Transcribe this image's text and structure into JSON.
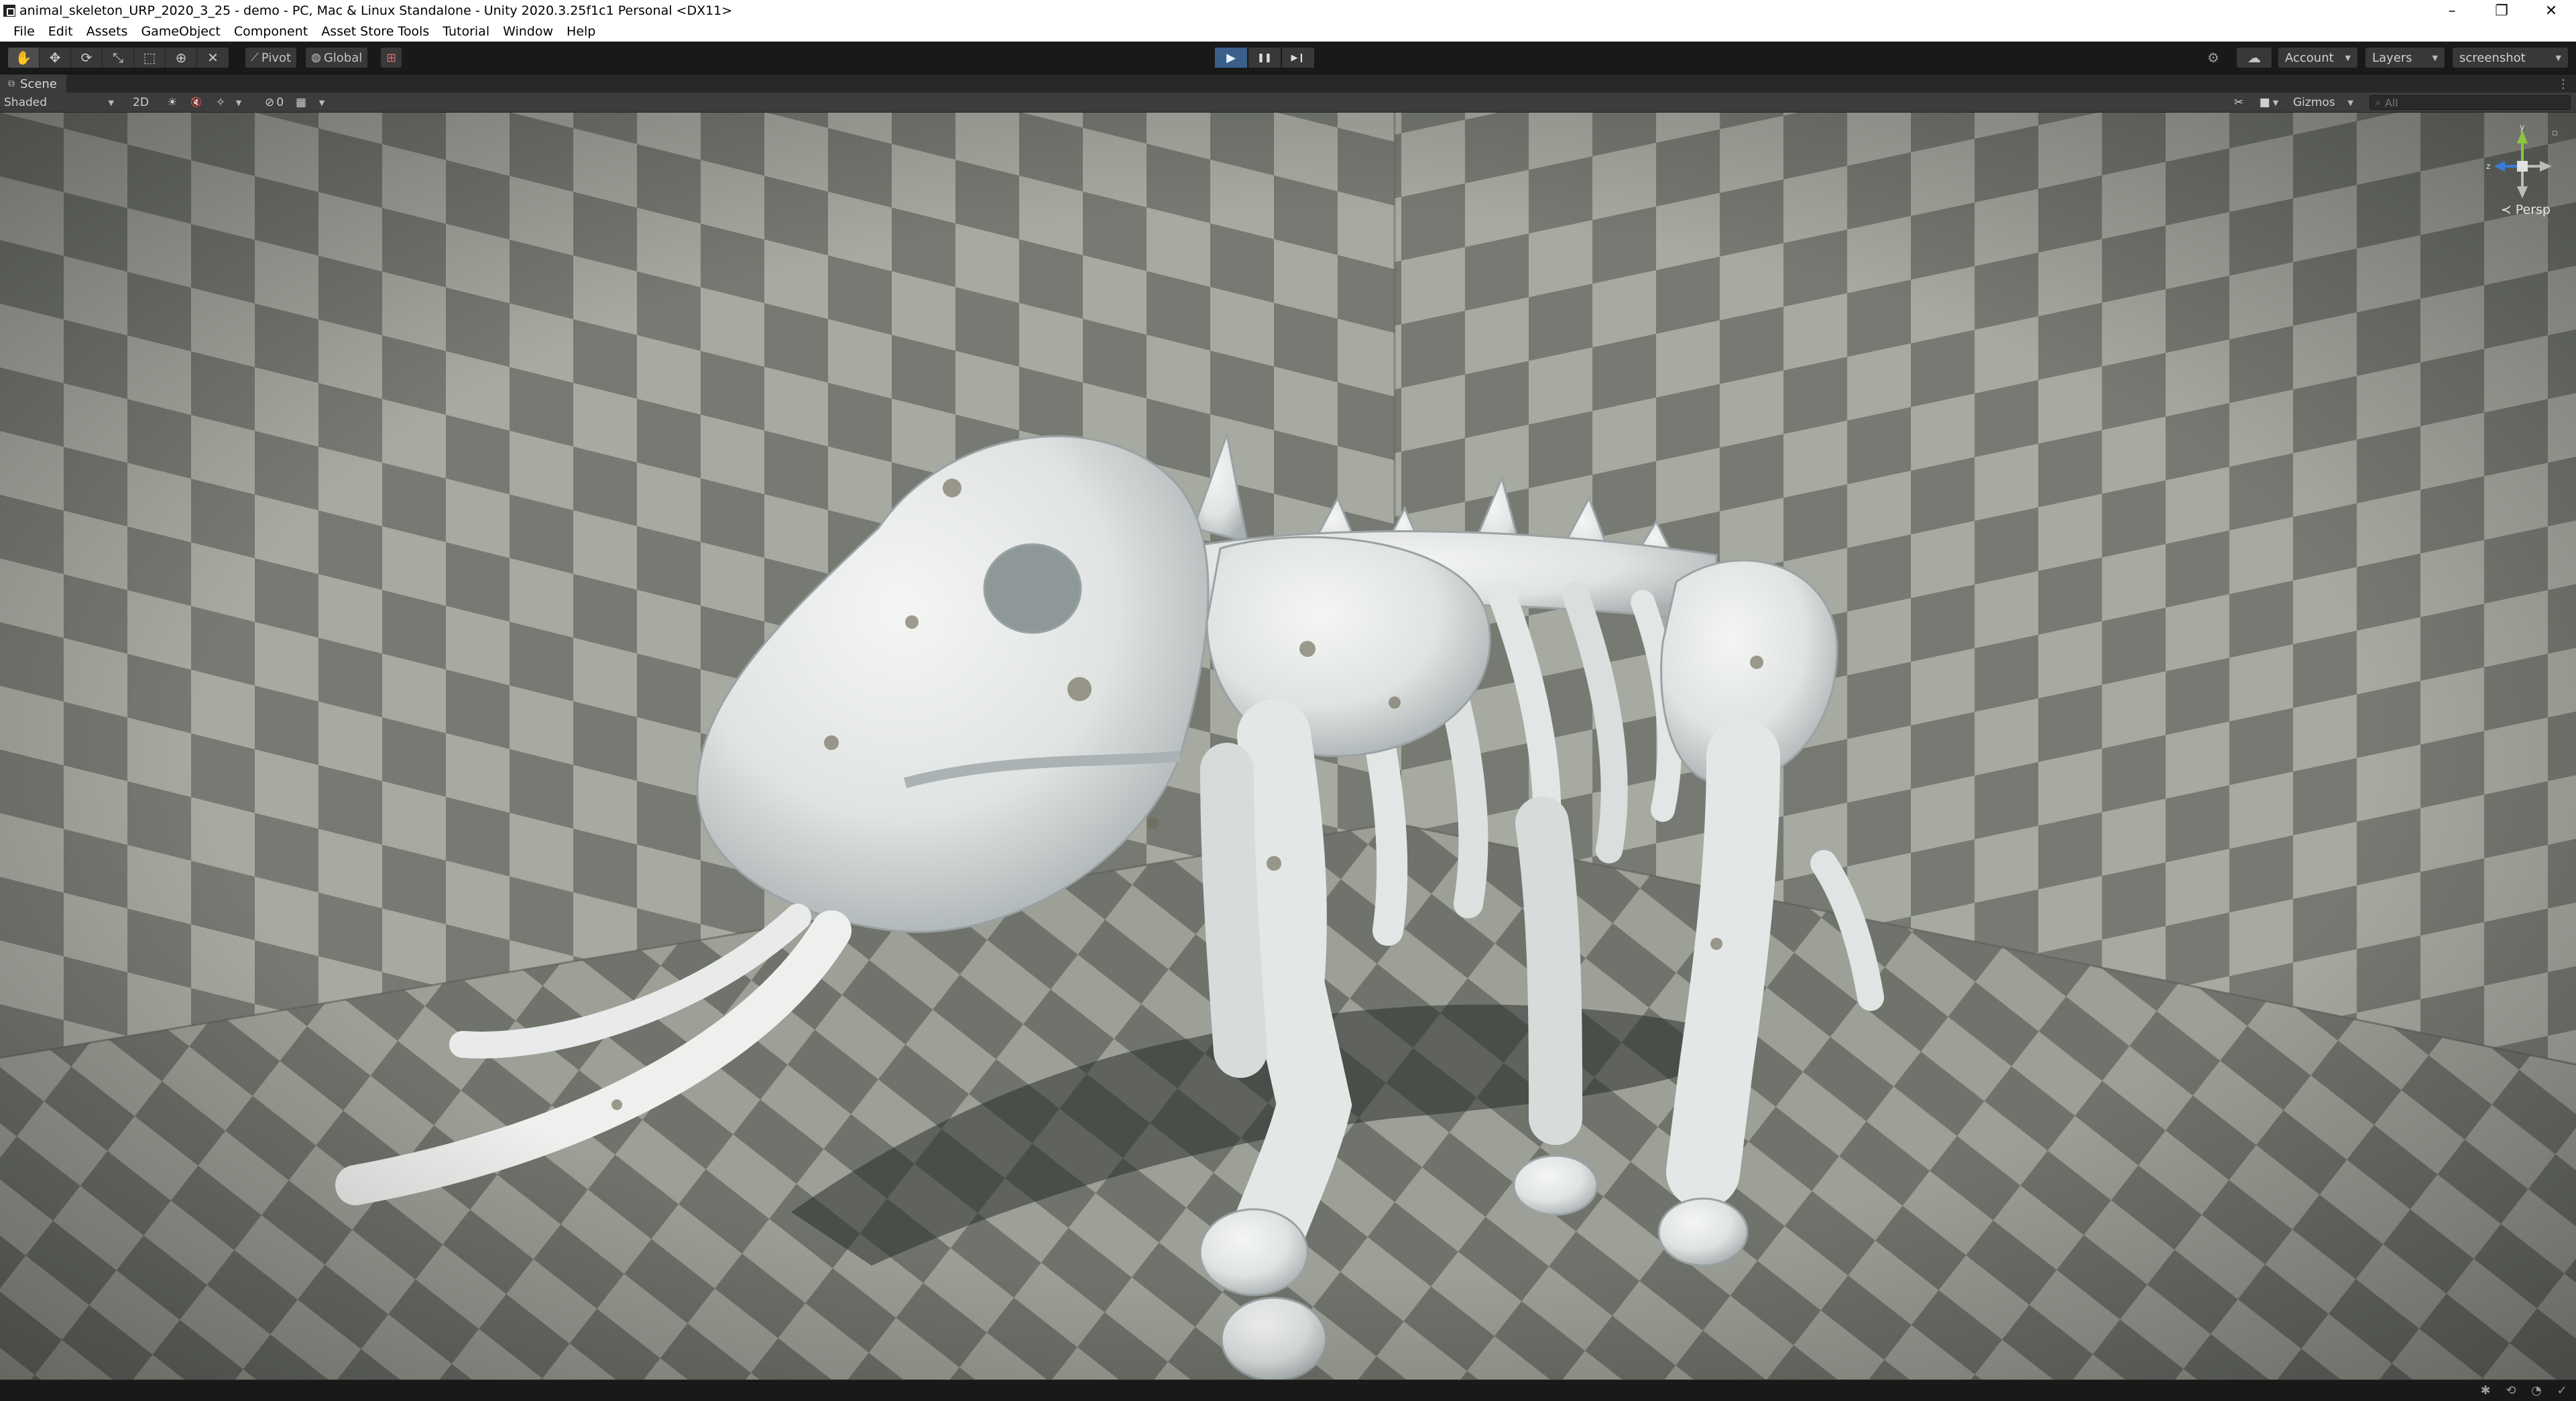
{
  "window": {
    "title": "animal_skeleton_URP_2020_3_25 - demo - PC, Mac & Linux Standalone - Unity 2020.3.25f1c1 Personal <DX11>",
    "controls": {
      "minimize": "–",
      "restore": "❐",
      "close": "✕"
    }
  },
  "menu": [
    "File",
    "Edit",
    "Assets",
    "GameObject",
    "Component",
    "Asset Store Tools",
    "Tutorial",
    "Window",
    "Help"
  ],
  "toolbar": {
    "tools": [
      {
        "name": "hand-tool-icon",
        "glyph": "✋"
      },
      {
        "name": "move-tool-icon",
        "glyph": "✥"
      },
      {
        "name": "rotate-tool-icon",
        "glyph": "⟳"
      },
      {
        "name": "scale-tool-icon",
        "glyph": "⤡"
      },
      {
        "name": "rect-tool-icon",
        "glyph": "⬚"
      },
      {
        "name": "transform-tool-icon",
        "glyph": "⊕"
      },
      {
        "name": "custom-tool-icon",
        "glyph": "✕"
      }
    ],
    "pivot_label": "Pivot",
    "global_label": "Global",
    "grid_snap_glyph": "⊞",
    "play_glyph": "▶",
    "pause_glyph": "❚❚",
    "step_glyph": "▶❙",
    "account_label": "Account",
    "layers_label": "Layers",
    "layout_label": "screenshot",
    "services_glyph": "⚙",
    "cloud_glyph": "☁"
  },
  "scene_tab": {
    "label": "Scene",
    "icon_glyph": "⧉",
    "menu_glyph": "⋮"
  },
  "scene_toolbar": {
    "shading_mode": "Shaded",
    "two_d_label": "2D",
    "lighting_glyph": "☀",
    "audio_glyph": "🔇",
    "effects_glyph": "✧",
    "hidden_count": "0",
    "grid_glyph": "▦",
    "tools_glyph": "✂",
    "camera_glyph": "■",
    "gizmos_label": "Gizmos",
    "search_placeholder": "All"
  },
  "gizmo": {
    "y_label": "y",
    "z_label": "z",
    "persp_label": "≺ Persp"
  },
  "colors": {
    "editor_bg": "#191919",
    "panel": "#3c3c3c",
    "play_active": "#3a5f8a",
    "checker_light": "#a5a89f",
    "checker_dark": "#747870",
    "bone": "#e4e7e4"
  }
}
